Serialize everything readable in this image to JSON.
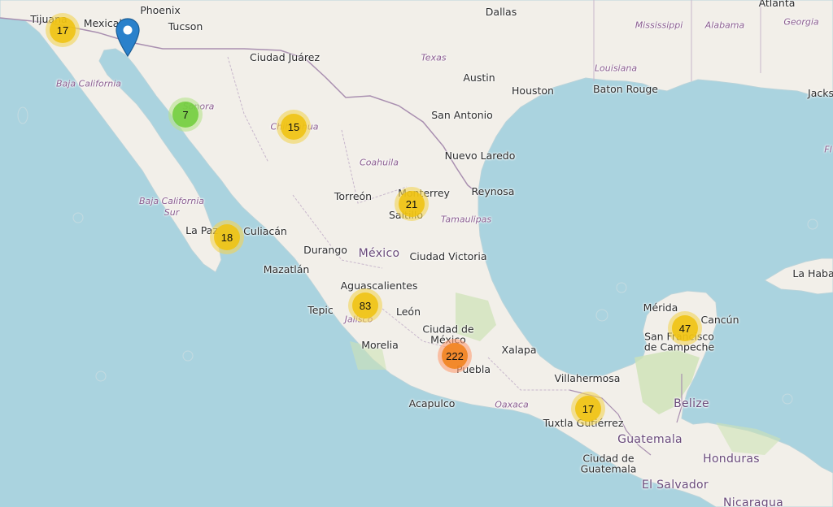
{
  "colors": {
    "water": "#aad3df",
    "land": "#f2efe9",
    "green": "#cde2b5",
    "cluster_small_outer": "rgba(181,226,140,0.6)",
    "cluster_small_inner": "rgba(110,204,57,0.85)",
    "cluster_medium_outer": "rgba(241,211,87,0.6)",
    "cluster_medium_inner": "rgba(240,194,12,0.85)",
    "cluster_large_outer": "rgba(253,156,115,0.6)",
    "cluster_large_inner": "rgba(241,128,23,0.85)",
    "pin": "#2a81cb"
  },
  "marker": {
    "icon": "map-pin-icon"
  },
  "clusters": [
    {
      "count": "17"
    },
    {
      "count": "7"
    },
    {
      "count": "15"
    },
    {
      "count": "21"
    },
    {
      "count": "18"
    },
    {
      "count": "83"
    },
    {
      "count": "222"
    },
    {
      "count": "17"
    },
    {
      "count": "47"
    }
  ],
  "labels": {
    "cities": [
      "Tijuana",
      "Mexicali",
      "Phoenix",
      "Tucson",
      "Dallas",
      "Atlanta",
      "Ciudad Juárez",
      "Austin",
      "Houston",
      "Baton Rouge",
      "Jacks",
      "San Antonio",
      "Nuevo Laredo",
      "Torreón",
      "Monterrey",
      "Saltillo",
      "Reynosa",
      "La Paz",
      "Culiacán",
      "Durango",
      "Ciudad Victoria",
      "Mazatlán",
      "Aguascalientes",
      "Tepic",
      "León",
      "Ciudad de México",
      "Morelia",
      "Xalapa",
      "Puebla",
      "Acapulco",
      "Villahermosa",
      "Tuxtla Gutiérrez",
      "Mérida",
      "Cancún",
      "San Francisco de Campeche",
      "Ciudad de Guatemala",
      "La Haba"
    ],
    "states": [
      "Mississippi",
      "Alabama",
      "Georgia",
      "Texas",
      "Louisiana",
      "Baja California",
      "Sonora",
      "Chihuahua",
      "Coahuila",
      "Baja California Sur",
      "Tamaulipas",
      "Jalisco",
      "Oaxaca",
      "Fl"
    ],
    "countries": [
      "México",
      "Guatemala",
      "Belize",
      "Honduras",
      "El Salvador",
      "Nicaragua"
    ]
  }
}
